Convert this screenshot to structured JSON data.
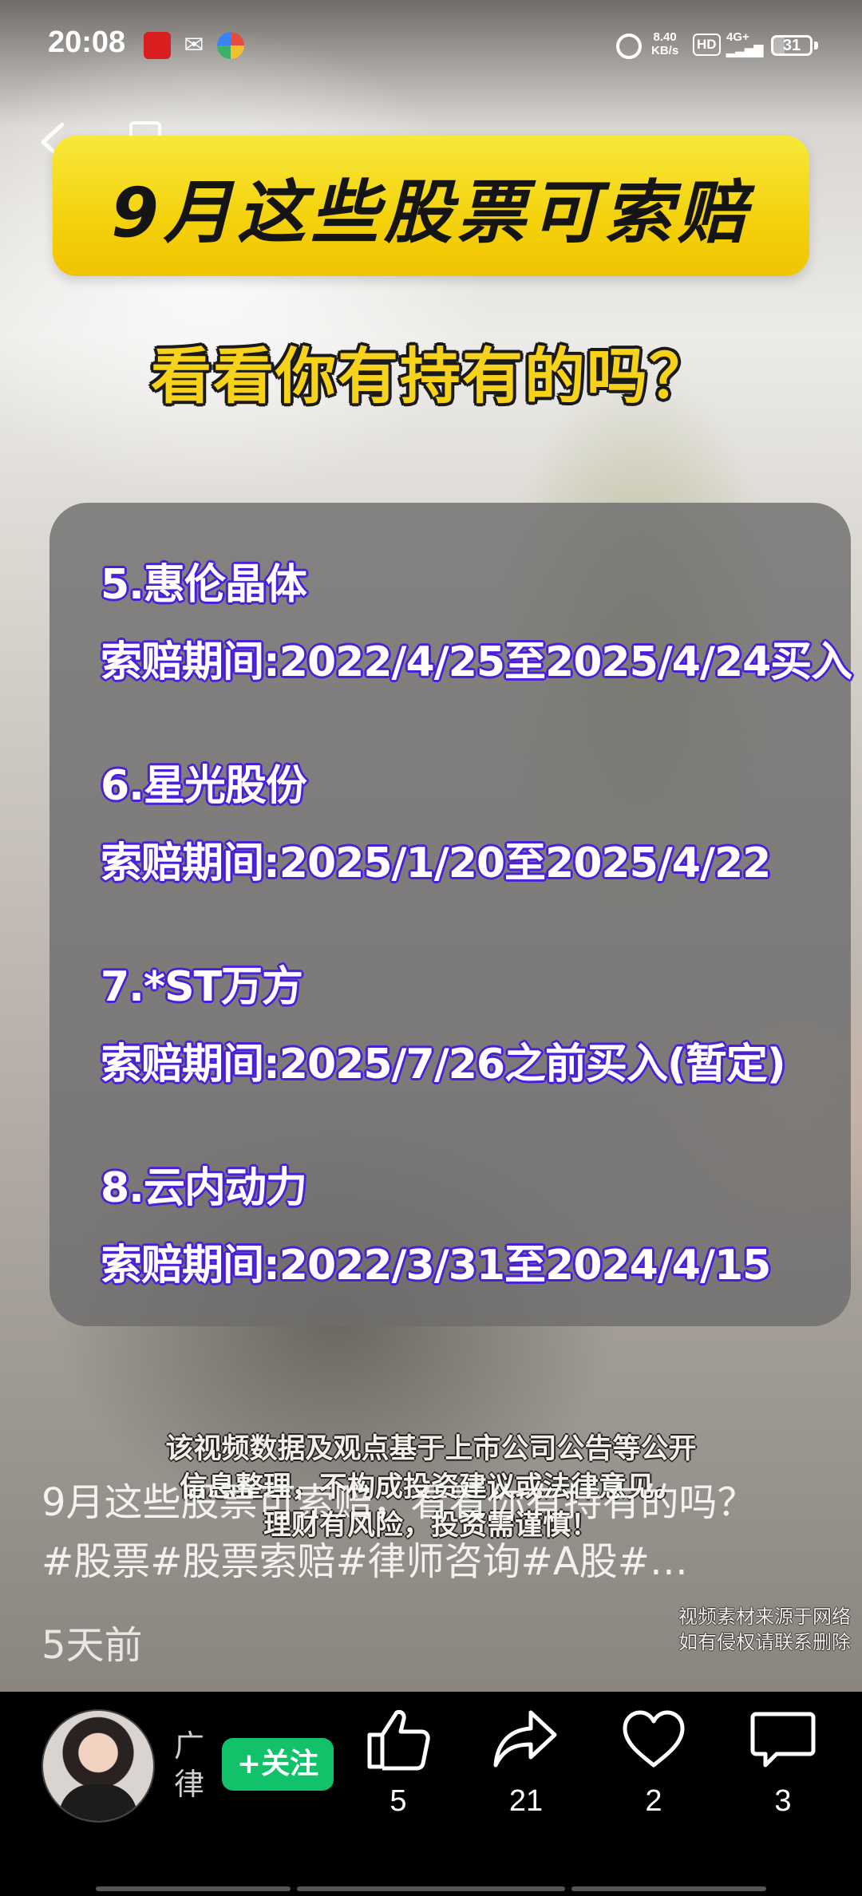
{
  "status_bar": {
    "time": "20:08",
    "net_speed": "8.40",
    "net_speed_unit": "KB/s",
    "hd": "HD",
    "network": "4G+",
    "battery": "31",
    "battery_level_percent": 31
  },
  "video": {
    "banner_title": "9月这些股票可索赔",
    "subtitle": "看看你有持有的吗？",
    "entries": [
      {
        "name": "5.惠伦晶体",
        "period": "索赔期间:2022/4/25至2025/4/24买入"
      },
      {
        "name": "6.星光股份",
        "period": "索赔期间:2025/1/20至2025/4/22"
      },
      {
        "name": "7.*ST万方",
        "period": "索赔期间:2025/7/26之前买入(暂定)"
      },
      {
        "name": "8.云内动力",
        "period": "索赔期间:2022/3/31至2024/4/15"
      }
    ],
    "disclaimer_line1": "该视频数据及观点基于上市公司公告等公开",
    "disclaimer_line2": "信息整理，不构成投资建议或法律意见。",
    "disclaimer_line3": "理财有风险，投资需谨慎！",
    "source_line1": "视频素材来源于网络",
    "source_line2": "如有侵权请联系删除"
  },
  "post": {
    "caption_line1": "9月这些股票可索赔，看看你有持有的吗？",
    "caption_line2": "#股票#股票索赔#律师咨询#A股#…",
    "age": "5天前"
  },
  "bottom": {
    "author_line1": "广",
    "author_line2": "律",
    "follow_label": "+关注",
    "like_count": "5",
    "share_count": "21",
    "favorite_count": "2",
    "comment_count": "3"
  }
}
